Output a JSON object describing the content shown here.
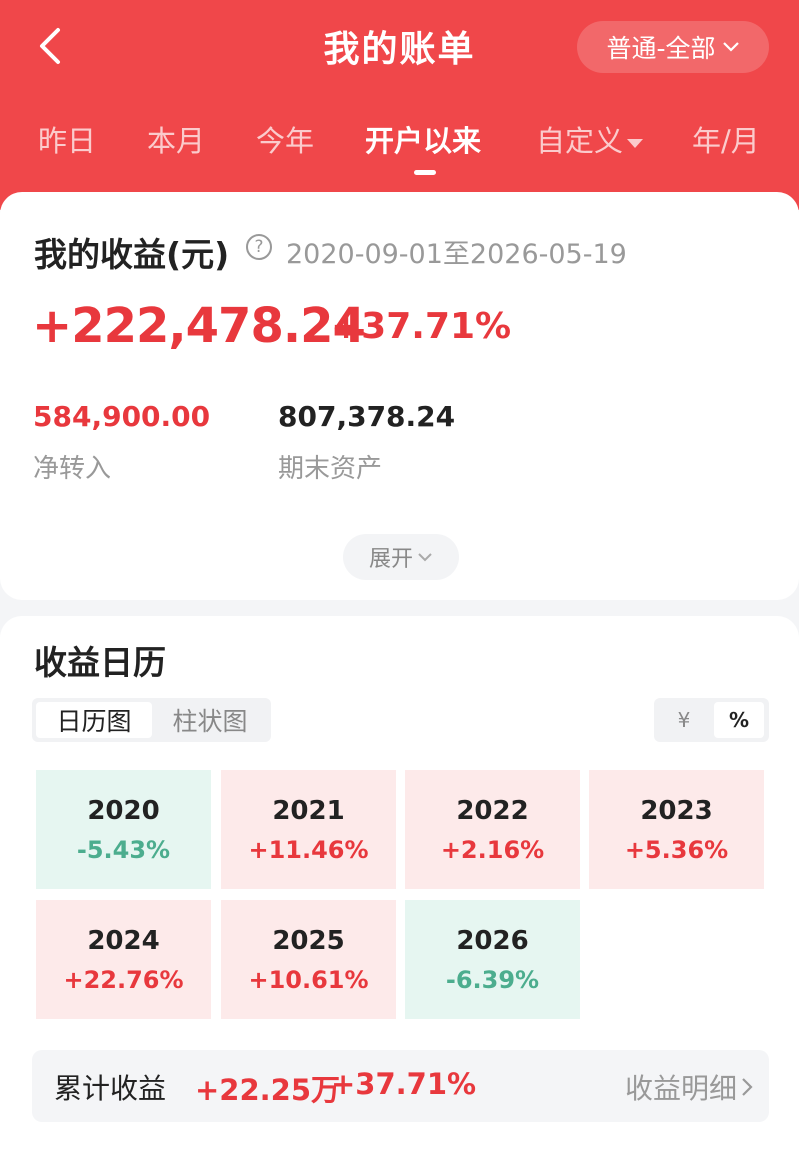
{
  "header": {
    "title": "我的账单",
    "account_filter": "普通-全部",
    "tabs": [
      "昨日",
      "本月",
      "今年",
      "开户以来",
      "自定义",
      "年/月"
    ]
  },
  "summary_card": {
    "title": "我的收益(元)",
    "date_range": "2020-09-01至2026-05-19",
    "profit": "+222,478.24",
    "profit_pct": "+37.71%",
    "net_transfer_value": "584,900.00",
    "net_transfer_label": "净转入",
    "end_assets_value": "807,378.24",
    "end_assets_label": "期末资产",
    "expand_label": "展开"
  },
  "calendar": {
    "title": "收益日历",
    "view_tabs": [
      "日历图",
      "柱状图"
    ],
    "unit_tabs": [
      "¥",
      "%"
    ],
    "years": [
      {
        "year": "2020",
        "pct": "-5.43%",
        "dir": "down"
      },
      {
        "year": "2021",
        "pct": "+11.46%",
        "dir": "up"
      },
      {
        "year": "2022",
        "pct": "+2.16%",
        "dir": "up"
      },
      {
        "year": "2023",
        "pct": "+5.36%",
        "dir": "up"
      },
      {
        "year": "2024",
        "pct": "+22.76%",
        "dir": "up"
      },
      {
        "year": "2025",
        "pct": "+10.61%",
        "dir": "up"
      },
      {
        "year": "2026",
        "pct": "-6.39%",
        "dir": "down"
      }
    ],
    "cumulative_label": "累计收益",
    "cumulative_amount": "+22.25万",
    "cumulative_pct": "+37.71%",
    "detail_link": "收益明细"
  },
  "colors": {
    "brand_red": "#f0474a",
    "gain_red": "#e8383d",
    "loss_green": "#4cad8e"
  }
}
